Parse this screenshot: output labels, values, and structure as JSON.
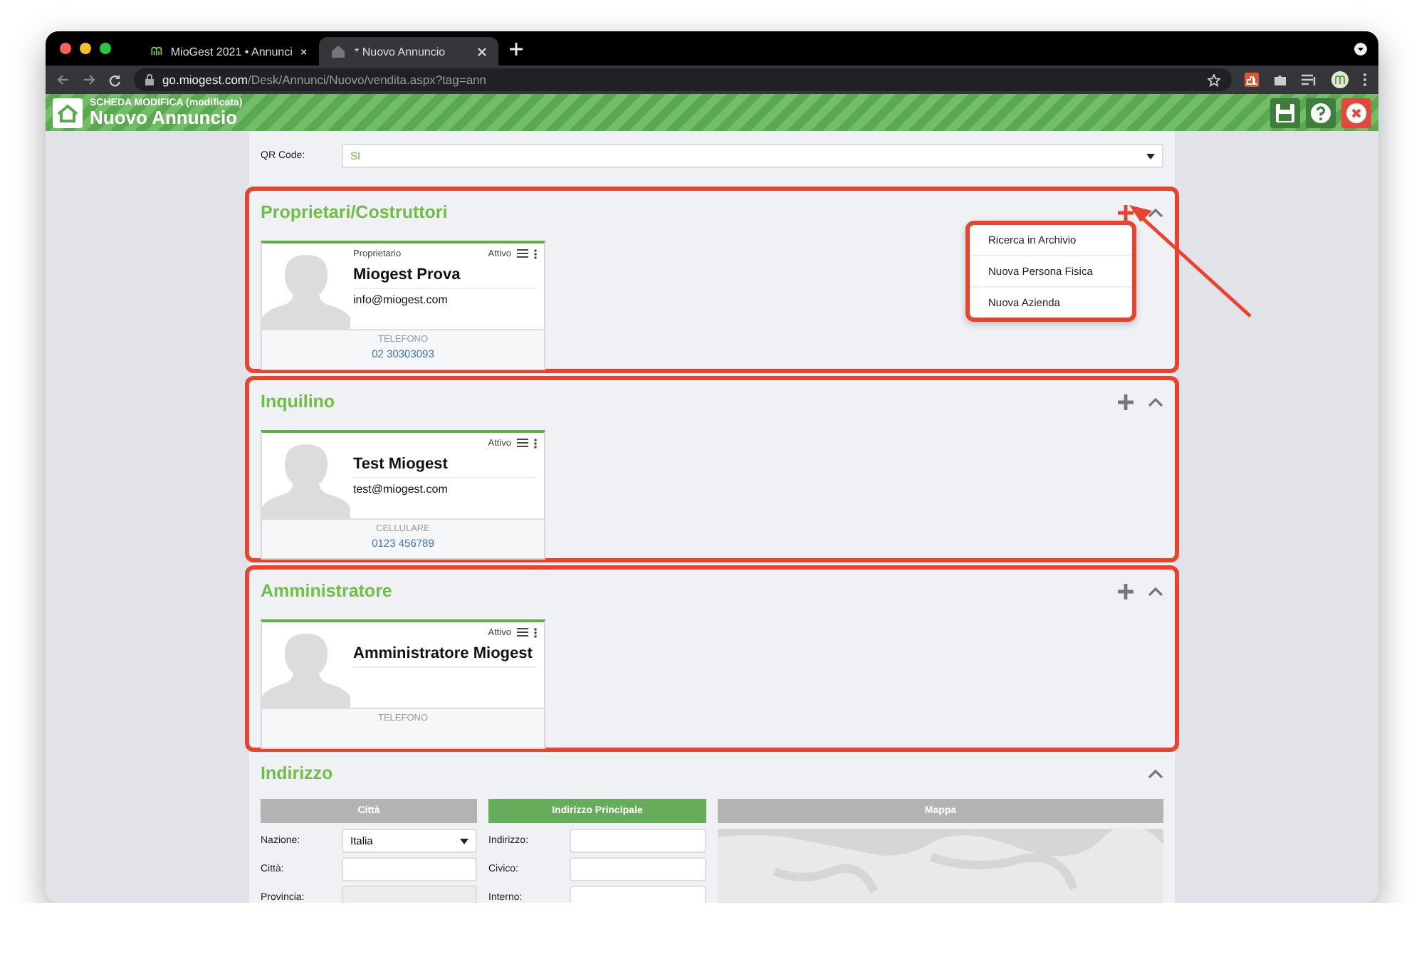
{
  "browser": {
    "tabs": [
      {
        "title": "MioGest 2021 • Annunci",
        "selected": false
      },
      {
        "title": "* Nuovo Annuncio",
        "selected": true
      }
    ],
    "url": {
      "host": "go.miogest.com",
      "path": "/Desk/Annunci/Nuovo/vendita.aspx?tag=ann"
    }
  },
  "app_header": {
    "subtitle": "SCHEDA MODIFICA (modificata)",
    "title": "Nuovo Annuncio"
  },
  "qr_code": {
    "label": "QR Code:",
    "value": "SI"
  },
  "sections": [
    {
      "title": "Proprietari/Costruttori",
      "highlighted": true,
      "add_highlighted": true,
      "menu": {
        "highlighted": true,
        "items": [
          "Ricerca in Archivio",
          "Nuova Persona Fisica",
          "Nuova Azienda"
        ]
      },
      "contacts": [
        {
          "role": "Proprietario",
          "status": "Attivo",
          "name": "Miogest Prova",
          "email": "info@miogest.com",
          "phone_label": "TELEFONO",
          "phone": "02 30303093"
        }
      ]
    },
    {
      "title": "Inquilino",
      "highlighted": true,
      "add_highlighted": false,
      "contacts": [
        {
          "status": "Attivo",
          "name": "Test Miogest",
          "email": "test@miogest.com",
          "phone_label": "CELLULARE",
          "phone": "0123 456789"
        }
      ]
    },
    {
      "title": "Amministratore",
      "highlighted": true,
      "add_highlighted": false,
      "contacts": [
        {
          "status": "Attivo",
          "name": "Amministratore Miogest",
          "phone_label": "TELEFONO"
        }
      ]
    }
  ],
  "address": {
    "title": "Indirizzo",
    "columns": [
      {
        "kind": "fields",
        "header": "Città",
        "selected": false,
        "fields": [
          {
            "label": "Nazione:",
            "kind": "select",
            "value": "Italia",
            "disabled": false
          },
          {
            "label": "Città:",
            "kind": "text",
            "disabled": false
          },
          {
            "label": "Provincia:",
            "kind": "text",
            "disabled": true
          }
        ]
      },
      {
        "kind": "fields",
        "header": "Indirizzo Principale",
        "selected": true,
        "fields": [
          {
            "label": "Indirizzo:",
            "kind": "text",
            "disabled": false
          },
          {
            "label": "Civico:",
            "kind": "text",
            "disabled": false
          },
          {
            "label": "Interno:",
            "kind": "text",
            "disabled": false
          }
        ]
      },
      {
        "kind": "map",
        "header": "Mappa",
        "selected": false
      }
    ]
  },
  "annotation_arrow": true
}
